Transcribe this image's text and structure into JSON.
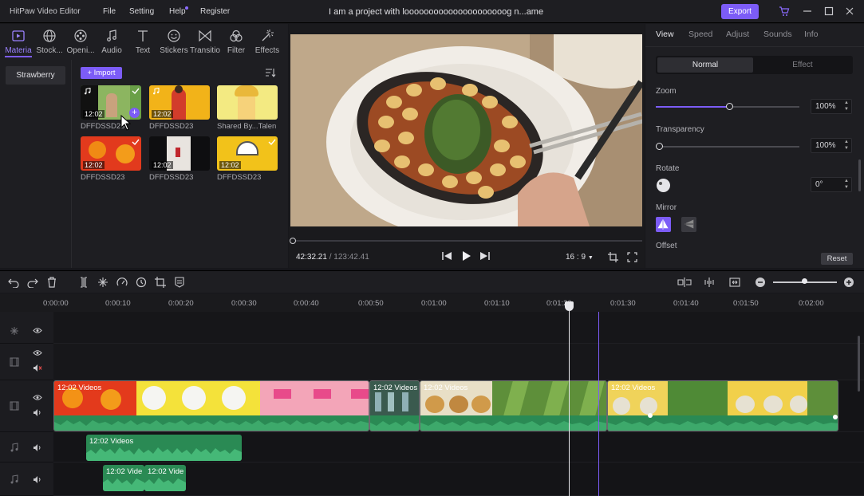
{
  "app": {
    "title": "HitPaw Video Editor",
    "project": "I am a project with looooooooooooooooooooog n...ame"
  },
  "menu": [
    "File",
    "Setting",
    "Help",
    "Register"
  ],
  "export_label": "Export",
  "toolbar": [
    "Materia",
    "Stock...",
    "Openi...",
    "Audio",
    "Text",
    "Stickers",
    "Transitio",
    "Filter",
    "Effects"
  ],
  "category": "Strawberry",
  "import_label": "Import",
  "media": [
    {
      "name": "DFFDSSD23",
      "duration": "12:02"
    },
    {
      "name": "DFFDSSD23",
      "duration": "12:02"
    },
    {
      "name": "Shared By...Talen",
      "duration": ""
    },
    {
      "name": "DFFDSSD23",
      "duration": "12:02"
    },
    {
      "name": "DFFDSSD23",
      "duration": "12:02"
    },
    {
      "name": "DFFDSSD23",
      "duration": "12:02"
    }
  ],
  "player": {
    "current": "42:32.21",
    "total": "/ 123:42.41",
    "ratio": "16 : 9",
    "progress": 0.0
  },
  "props": {
    "tabs": [
      "View",
      "Speed",
      "Adjust",
      "Sounds",
      "Info"
    ],
    "modes": [
      "Normal",
      "Effect"
    ],
    "zoom_label": "Zoom",
    "zoom_value": "100%",
    "zoom_level": 0.51,
    "transparency_label": "Transparency",
    "transparency_value": "100%",
    "transparency_level": 0.0,
    "rotate_label": "Rotate",
    "rotate_value": "0°",
    "mirror_label": "Mirror",
    "offset_label": "Offset",
    "reset_label": "Reset"
  },
  "ruler": [
    "0:00:00",
    "0:00:10",
    "0:00:20",
    "0:00:30",
    "0:00:40",
    "0:00:50",
    "0:01:00",
    "0:01:10",
    "0:01:20",
    "0:01:30",
    "0:01:40",
    "0:01:50",
    "0:02:00"
  ],
  "clips": {
    "video1": "12:02  Videos",
    "video2": "12:02  Videos",
    "video3": "12:02  Videos",
    "video4": "12:02  Videos",
    "audio1": "12:02  Videos",
    "audio2a": "12:02  Vide",
    "audio2b": "12:02  Vide"
  }
}
